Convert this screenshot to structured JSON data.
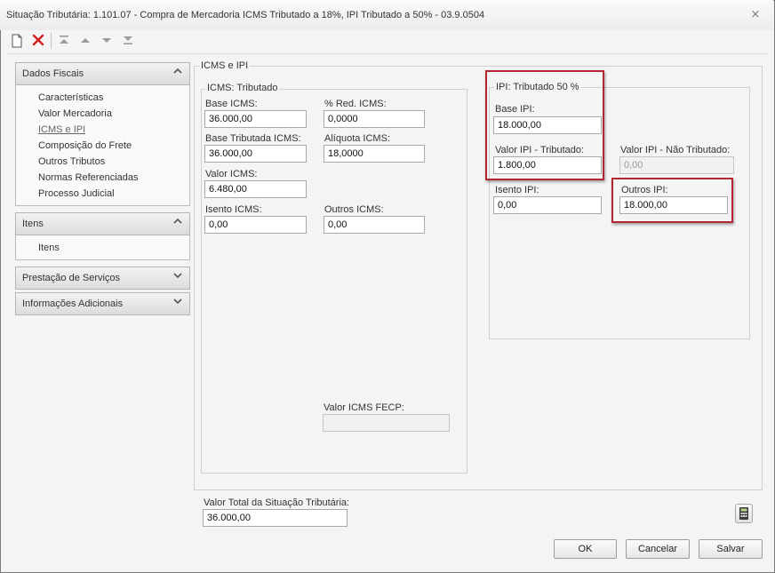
{
  "window": {
    "title": "Situação Tributária: 1.101.07 - Compra de Mercadoria ICMS Tributado a 18%, IPI Tributado a 50% - 03.9.0504",
    "close_glyph": "⨯"
  },
  "toolbar": {
    "new_icon": "new-document-icon",
    "delete_icon": "delete-icon",
    "first_icon": "move-first-icon",
    "up_icon": "move-up-icon",
    "down_icon": "move-down-icon",
    "last_icon": "move-last-icon"
  },
  "sidebar": {
    "sections": [
      {
        "label": "Dados Fiscais",
        "items": [
          "Características",
          "Valor Mercadoria",
          "ICMS e IPI",
          "Composição do Frete",
          "Outros Tributos",
          "Normas Referenciadas",
          "Processo Judicial"
        ]
      },
      {
        "label": "Itens",
        "items": [
          "Itens"
        ]
      },
      {
        "label": "Prestação de Serviços",
        "items": []
      },
      {
        "label": "Informações Adicionais",
        "items": []
      }
    ],
    "active_item": "ICMS e IPI"
  },
  "main": {
    "group_title": "ICMS e IPI",
    "icms": {
      "title": "ICMS: Tributado",
      "base_icms_label": "Base ICMS:",
      "base_icms_value": "36.000,00",
      "red_icms_label": "% Red. ICMS:",
      "red_icms_value": "0,0000",
      "base_trib_label": "Base Tributada ICMS:",
      "base_trib_value": "36.000,00",
      "aliquota_label": "Alíquota ICMS:",
      "aliquota_value": "18,0000",
      "valor_icms_label": "Valor ICMS:",
      "valor_icms_value": "6.480,00",
      "isento_label": "Isento ICMS:",
      "isento_value": "0,00",
      "outros_label": "Outros ICMS:",
      "outros_value": "0,00",
      "fecp_label": "Valor ICMS FECP:",
      "fecp_value": ""
    },
    "ipi": {
      "title": "IPI: Tributado 50 %",
      "base_label": "Base IPI:",
      "base_value": "18.000,00",
      "valor_trib_label": "Valor IPI - Tributado:",
      "valor_trib_value": "1.800,00",
      "valor_nao_trib_label": "Valor IPI - Não Tributado:",
      "valor_nao_trib_value": "0,00",
      "isento_label": "Isento IPI:",
      "isento_value": "0,00",
      "outros_label": "Outros IPI:",
      "outros_value": "18.000,00"
    },
    "total_label": "Valor Total da Situação Tributária:",
    "total_value": "36.000,00"
  },
  "footer": {
    "calculator_icon": "calculator-icon",
    "ok_label": "OK",
    "cancel_label": "Cancelar",
    "save_label": "Salvar"
  },
  "colors": {
    "highlight_border": "#b3262f",
    "delete_icon": "#d22020"
  }
}
